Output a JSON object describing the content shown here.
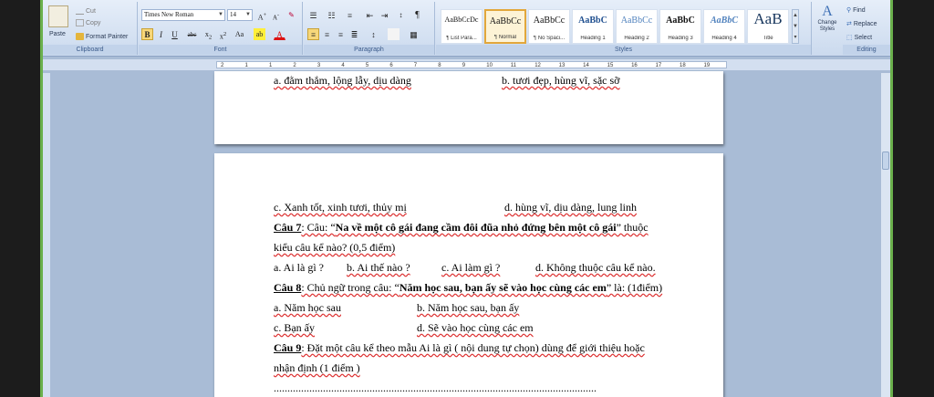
{
  "ribbon": {
    "clipboard": {
      "paste": "Paste",
      "cut": "Cut",
      "copy": "Copy",
      "format_painter": "Format Painter",
      "label": "Clipboard"
    },
    "font": {
      "name": "Times New Roman",
      "size": "14",
      "label": "Font"
    },
    "paragraph": {
      "label": "Paragraph"
    },
    "styles": {
      "label": "Styles",
      "items": [
        {
          "sample": "AaBbCcDc",
          "name": "¶ List Para..."
        },
        {
          "sample": "AaBbCc",
          "name": "¶ Normal"
        },
        {
          "sample": "AaBbCc",
          "name": "¶ No Spaci..."
        },
        {
          "sample": "AaBbC",
          "name": "Heading 1"
        },
        {
          "sample": "AaBbCc",
          "name": "Heading 2"
        },
        {
          "sample": "AaBbC",
          "name": "Heading 3"
        },
        {
          "sample": "AaBbC",
          "name": "Heading 4"
        },
        {
          "sample": "AaB",
          "name": "Title"
        }
      ],
      "change_styles": "Change Styles"
    },
    "editing": {
      "find": "Find",
      "replace": "Replace",
      "select": "Select",
      "label": "Editing"
    }
  },
  "ruler": {
    "ticks": [
      "2",
      "1",
      "1",
      "2",
      "3",
      "4",
      "5",
      "6",
      "7",
      "8",
      "9",
      "10",
      "11",
      "12",
      "13",
      "14",
      "15",
      "16",
      "17",
      "18",
      "19"
    ]
  },
  "document": {
    "page1": {
      "line_a": "a. đằm thắm, lộng lẫy, dịu dàng",
      "line_b": "b. tươi đẹp, hùng vĩ, sặc sỡ"
    },
    "page2": {
      "opt_c": "c. Xanh tốt, xinh tươi, thủy mị",
      "opt_d": "d. hùng vĩ, dịu dàng, lung linh",
      "q7_label": "Câu 7",
      "q7_pre": ": Câu: “",
      "q7_bold": "Na về một cô gái đang cầm đôi đũa nhỏ đứng bên một cô gái",
      "q7_post": "” thuộc",
      "q7_line2": "kiểu câu kể nào? (0,5 điểm)",
      "q7_a": "a.  Ai là gì ?",
      "q7_b": "b.   Ai thế nào ?",
      "q7_c": "c.   Ai làm gì ?",
      "q7_d": "d.   Không thuộc câu kể nào.",
      "q8_label": "Câu 8",
      "q8_pre": ": Chủ ngữ trong câu: “",
      "q8_bold": "Năm học sau, bạn ấy sẽ vào học cùng các em",
      "q8_post": "” là: (1điểm)",
      "q8_a": "a. Năm học sau",
      "q8_b": "b. Năm học sau, bạn ấy",
      "q8_c": "c. Bạn ấy",
      "q8_d": "d. Sẽ vào học cùng các em",
      "q9_label": "Câu 9",
      "q9_text": ": Đặt một câu kể theo mẫu Ai là gì ( nội dung tự chọn) dùng để giới thiệu hoặc",
      "q9_line2": "nhận định  (1 điểm )",
      "dots": "......................................................................................................................"
    }
  }
}
